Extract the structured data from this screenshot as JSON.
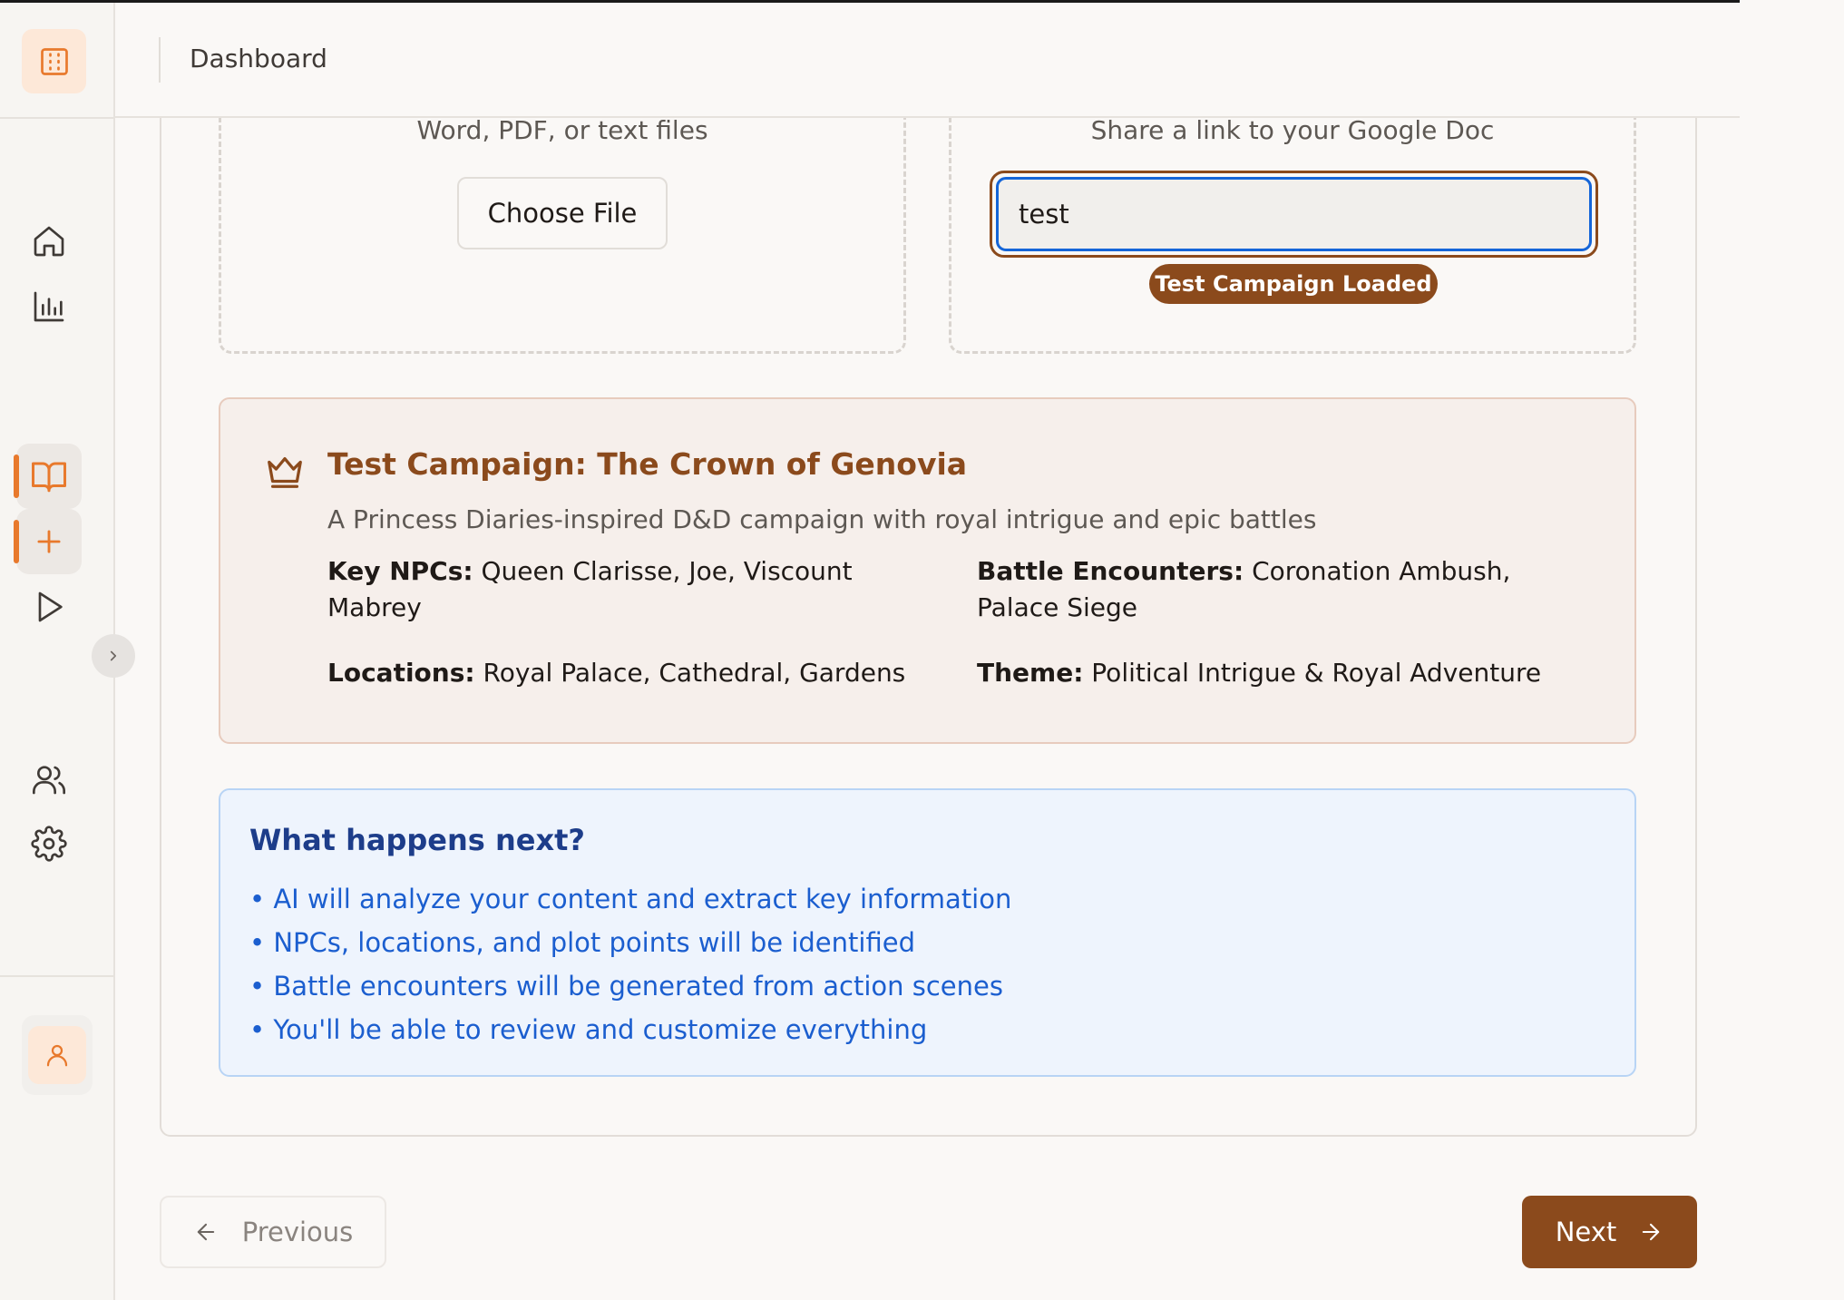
{
  "header": {
    "title": "Dashboard"
  },
  "upload": {
    "file_subtitle": "Word, PDF, or text files",
    "choose_file_label": "Choose File",
    "doc_subtitle": "Share a link to your Google Doc",
    "doc_input_value": "test",
    "loaded_badge": "Test Campaign Loaded"
  },
  "campaign": {
    "title": "Test Campaign: The Crown of Genovia",
    "description": "A Princess Diaries-inspired D&D campaign with royal intrigue and epic battles",
    "npcs_label": "Key NPCs:",
    "npcs_value": "Queen Clarisse, Joe, Viscount Mabrey",
    "battles_label": "Battle Encounters:",
    "battles_value": "Coronation Ambush, Palace Siege",
    "locations_label": "Locations:",
    "locations_value": "Royal Palace, Cathedral, Gardens",
    "theme_label": "Theme:",
    "theme_value": "Political Intrigue & Royal Adventure"
  },
  "next_info": {
    "title": "What happens next?",
    "items": [
      "• AI will analyze your content and extract key information",
      "• NPCs, locations, and plot points will be identified",
      "• Battle encounters will be generated from action scenes",
      "• You'll be able to review and customize everything"
    ]
  },
  "nav": {
    "previous_label": "Previous",
    "next_label": "Next"
  },
  "icons": {
    "logo": "layout-grid-icon",
    "home": "home-icon",
    "analytics": "bar-chart-icon",
    "campaigns": "book-open-icon",
    "create": "plus-icon",
    "play": "play-icon",
    "users": "users-icon",
    "settings": "gear-icon",
    "profile": "user-icon"
  },
  "colors": {
    "accent_orange": "#e8792c",
    "brand_brown": "#8b4a1c",
    "info_blue": "#1b5ecf",
    "focus_blue": "#1565d8"
  }
}
